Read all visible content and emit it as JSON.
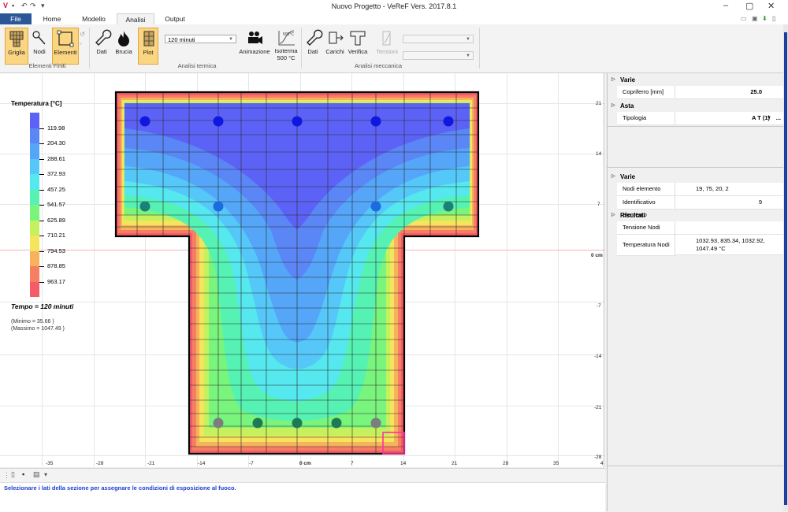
{
  "window": {
    "title": "Nuovo Progetto - VeReF Vers. 2017.8.1"
  },
  "tabs": [
    {
      "label": "File"
    },
    {
      "label": "Home"
    },
    {
      "label": "Modello"
    },
    {
      "label": "Analisi"
    },
    {
      "label": "Output"
    }
  ],
  "ribbon": {
    "groups": {
      "fem": "Elementi Finiti",
      "thermal": "Analisi termica",
      "mechanical": "Analisi meccanica"
    },
    "fem": {
      "griglia": "Griglia",
      "nodi": "Nodi",
      "elementi": "Elementi"
    },
    "thermal": {
      "dati": "Dati",
      "brucia": "Brucia",
      "plot": "Plot",
      "time_select": "120 minuti",
      "animazione": "Animazione",
      "isoterma_line1": "Isoterma",
      "isoterma_line2": "500 °C",
      "iso_icon_text": "500°C"
    },
    "mechanical": {
      "dati": "Dati",
      "carichi": "Carichi",
      "verifica": "Verifica",
      "tensioni": "Tensioni"
    }
  },
  "legend": {
    "title": "Temperatura [°C]",
    "values": [
      "119.98",
      "204.30",
      "288.61",
      "372.93",
      "457.25",
      "541.57",
      "625.89",
      "710.21",
      "794.53",
      "878.85",
      "963.17"
    ],
    "colors": [
      "#5d62f6",
      "#5a86f6",
      "#55a6f9",
      "#55c8f9",
      "#55e8ee",
      "#55f2b4",
      "#79f47d",
      "#c4f15e",
      "#f4e55c",
      "#f7b25e",
      "#f67e62",
      "#f45d66"
    ],
    "tempo": "Tempo = 120 minuti",
    "minimo": "(Minimo   = 35.66 )",
    "massimo": "(Massimo = 1047.49 )"
  },
  "axes": {
    "x_ticks": [
      "-35",
      "-28",
      "-21",
      "-14",
      "-7",
      "0 cm",
      "7",
      "14",
      "21",
      "28",
      "35",
      "4"
    ],
    "y_ticks": [
      "21",
      "14",
      "7",
      "0 cm",
      "-7",
      "-14",
      "-21",
      "-28"
    ]
  },
  "status": {
    "message": "Selezionare i lati della sezione per assegnare le condizioni di esposizione al fuoco."
  },
  "properties_top": {
    "varie": "Varie",
    "copriferro_label": "Copriferro [mm]",
    "copriferro_value": "25.0",
    "asta": "Asta",
    "tipologia_label": "Tipologia",
    "tipologia_value": "A T (1)"
  },
  "properties_bottom": {
    "varie": "Varie",
    "nodi_elemento_label": "Nodi elemento",
    "nodi_elemento_value": "19, 75, 20, 2",
    "identificativo_label": "Identificativo elemento",
    "identificativo_value": "9",
    "risultati": "Risultati",
    "tensione_label": "Tensione Nodi",
    "tensione_value": "",
    "temperatura_label": "Temperatura Nodi",
    "temperatura_value_1": "1032.93, 835.34, 1032.92,",
    "temperatura_value_2": "1047.49 °C"
  },
  "colors": {
    "accent": "#2b5797",
    "selected": "#fbd682",
    "status_text": "#1a3fcf",
    "selected_element": "#ff2fa8"
  }
}
